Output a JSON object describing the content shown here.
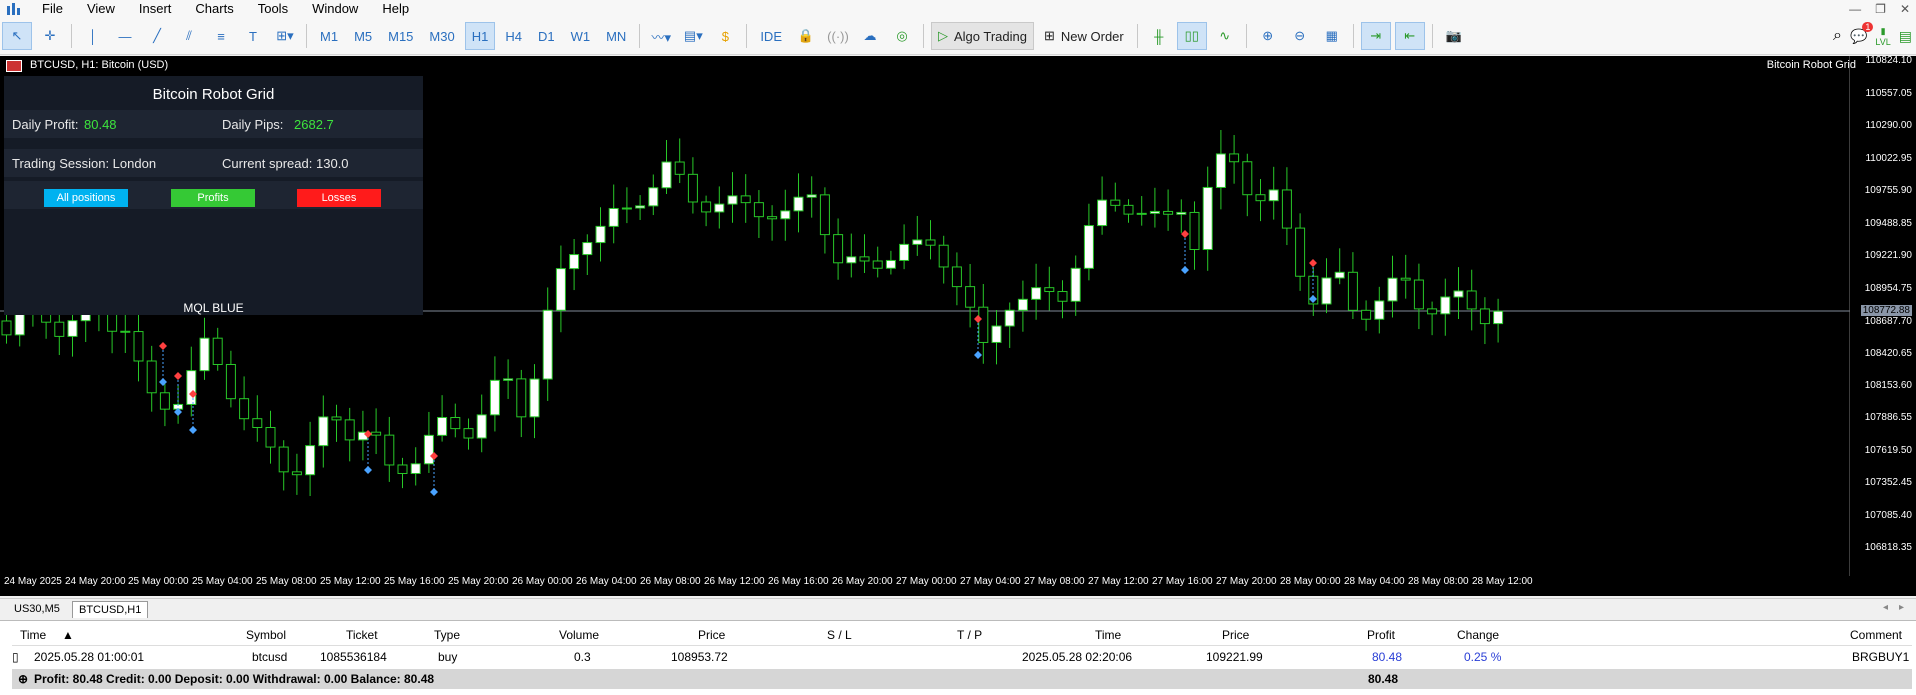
{
  "menu": {
    "items": [
      "File",
      "View",
      "Insert",
      "Charts",
      "Tools",
      "Window",
      "Help"
    ]
  },
  "toolbar": {
    "timeframes": [
      "M1",
      "M5",
      "M15",
      "M30",
      "H1",
      "H4",
      "D1",
      "W1",
      "MN"
    ],
    "active_timeframe": "H1",
    "ide_label": "IDE",
    "algo_label": "Algo Trading",
    "new_order_label": "New Order",
    "notification_count": "1",
    "lvl_label": "LVL"
  },
  "chart": {
    "title": "BTCUSD, H1:  Bitcoin (USD)",
    "ea_name": "Bitcoin Robot Grid",
    "current_price": "108772.88",
    "y_labels": [
      "110824.10",
      "110557.05",
      "110290.00",
      "110022.95",
      "109755.90",
      "109488.85",
      "109221.90",
      "108954.75",
      "108687.70",
      "108420.65",
      "108153.60",
      "107886.55",
      "107619.50",
      "107352.45",
      "107085.40",
      "106818.35"
    ],
    "x_labels": [
      "24 May 2025",
      "24 May 20:00",
      "25 May 00:00",
      "25 May 04:00",
      "25 May 08:00",
      "25 May 12:00",
      "25 May 16:00",
      "25 May 20:00",
      "26 May 00:00",
      "26 May 04:00",
      "26 May 08:00",
      "26 May 12:00",
      "26 May 16:00",
      "26 May 20:00",
      "27 May 00:00",
      "27 May 04:00",
      "27 May 08:00",
      "27 May 12:00",
      "27 May 16:00",
      "27 May 20:00",
      "28 May 00:00",
      "28 May 04:00",
      "28 May 08:00",
      "28 May 12:00"
    ]
  },
  "panel": {
    "title": "Bitcoin Robot Grid",
    "daily_profit_label": "Daily Profit:",
    "daily_profit_value": "80.48",
    "daily_pips_label": "Daily Pips:",
    "daily_pips_value": "2682.7",
    "session_label": "Trading Session: London",
    "spread_label": "Current spread:",
    "spread_value": "130.0",
    "btn_all": "All positions",
    "btn_profits": "Profits",
    "btn_losses": "Losses",
    "footer": "MQL BLUE",
    "colors": {
      "all": "#00b2f0",
      "profits": "#35c935",
      "losses": "#ff1b1b"
    }
  },
  "tabs": [
    "US30,M5",
    "BTCUSD,H1"
  ],
  "active_tab": "BTCUSD,H1",
  "terminal": {
    "headers": [
      "Time",
      "Symbol",
      "Ticket",
      "Type",
      "Volume",
      "Price",
      "S / L",
      "T / P",
      "Time",
      "Price",
      "Profit",
      "Change",
      "Comment"
    ],
    "row": [
      "2025.05.28 01:00:01",
      "btcusd",
      "1085536184",
      "buy",
      "0.3",
      "108953.72",
      "",
      "",
      "2025.05.28 02:20:06",
      "109221.99",
      "80.48",
      "0.25 %",
      "BRGBUY1"
    ],
    "summary": "Profit: 80.48  Credit: 0.00  Deposit: 0.00  Withdrawal: 0.00  Balance: 80.48",
    "summary_profit": "80.48"
  }
}
